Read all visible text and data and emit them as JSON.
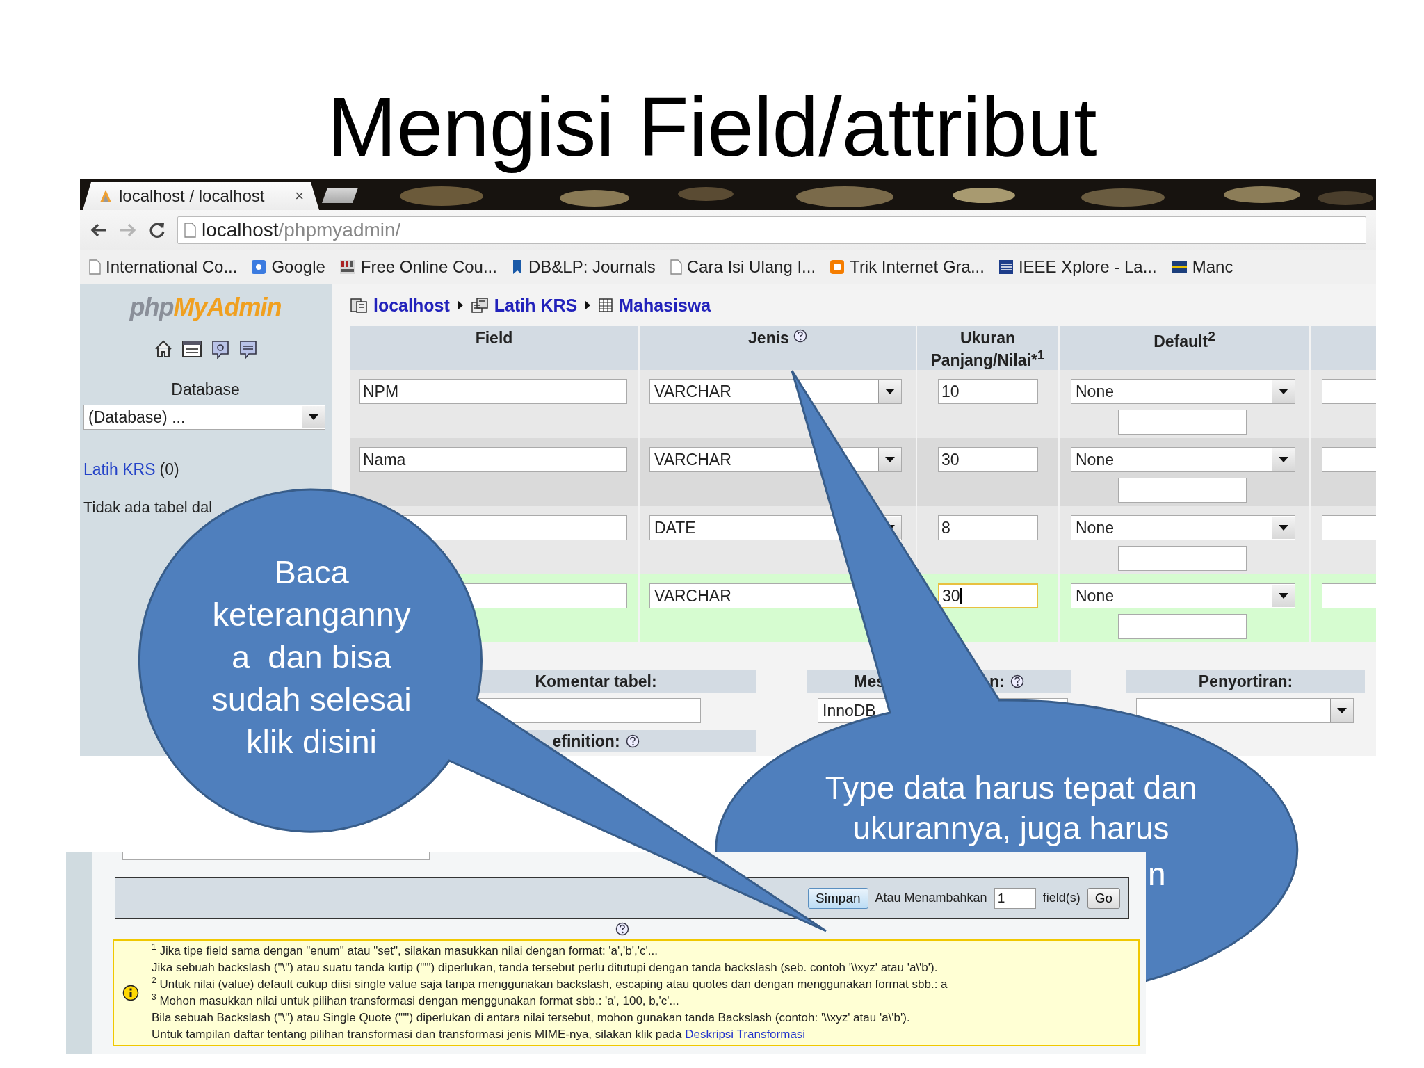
{
  "slide_title": "Mengisi Field/attribut",
  "browser": {
    "tab": {
      "title": "localhost / localhost",
      "close": "×"
    },
    "address": {
      "host": "localhost",
      "path": "/phpmyadmin/"
    },
    "bookmarks": [
      {
        "label": "International Co..."
      },
      {
        "label": "Google"
      },
      {
        "label": "Free Online Cou..."
      },
      {
        "label": "DB&LP: Journals"
      },
      {
        "label": "Cara Isi Ulang I..."
      },
      {
        "label": "Trik Internet Gra..."
      },
      {
        "label": "IEEE Xplore - La..."
      },
      {
        "label": "Manc"
      }
    ]
  },
  "sidebar": {
    "logo": {
      "part1": "php",
      "part2": "MyAdmin"
    },
    "database_label": "Database",
    "database_select": "(Database) ...",
    "db_link": "Latih KRS",
    "db_count": "(0)",
    "note": "Tidak ada tabel dal"
  },
  "breadcrumb": [
    {
      "label": "localhost"
    },
    {
      "label": "Latih KRS"
    },
    {
      "label": "Mahasiswa"
    }
  ],
  "columns": [
    {
      "label": "Field",
      "help": false
    },
    {
      "label": "Jenis",
      "help": true
    },
    {
      "label": "Ukuran Panjang/Nilai*",
      "note": "1",
      "help": false
    },
    {
      "label": "Default",
      "note": "2",
      "help": false
    }
  ],
  "rows": [
    {
      "field": "NPM",
      "type": "VARCHAR",
      "type_arrow_visible": true,
      "size": "10",
      "size_focused": false,
      "default": "None",
      "marked": false
    },
    {
      "field": "Nama",
      "type": "VARCHAR",
      "type_arrow_visible": true,
      "size": "30",
      "size_focused": false,
      "default": "None",
      "marked": false
    },
    {
      "type": "DATE",
      "type_arrow_visible": true,
      "size": "8",
      "size_focused": false,
      "default": "None",
      "marked": false
    },
    {
      "type": "VARCHAR",
      "type_arrow_visible": false,
      "size": "30",
      "size_focused": true,
      "default": "None",
      "marked": true
    }
  ],
  "table_options": {
    "comment_label": "Komentar tabel:",
    "definition_label": "efinition:",
    "engine_label_parts": [
      "Mes",
      "n:"
    ],
    "engine_value": "InnoDB",
    "sort_label": "Penyortiran:"
  },
  "save_bar": {
    "save_button": "Simpan",
    "add_label": "Atau Menambahkan",
    "add_count": "1",
    "add_unit": "field(s)",
    "go_button": "Go"
  },
  "notes": [
    {
      "text": "$^{1}$ Jika tipe field sama dengan \"enum\" atau \"set\", silakan masukkan nilai dengan format: 'a','b','c'..."
    },
    {
      "text": "Jika sebuah backslash (\"\\\") atau suatu tanda kutip (\"'\") diperlukan, tanda tersebut perlu ditutupi dengan tanda backslash (seb. contoh '\\\\xyz' atau 'a\\'b')."
    },
    {
      "text": "$^{2}$ Untuk nilai (value) default cukup diisi single value saja tanpa menggunakan backslash, escaping atau quotes dan dengan menggunakan format sbb.: a"
    },
    {
      "text": "$^{3}$ Mohon masukkan nilai untuk pilihan transformasi dengan menggunakan format sbb.: 'a', 100, b,'c'..."
    },
    {
      "text": "Bila sebuah Backslash (\"\\\") atau Single Quote (\"'\") diperlukan di antara nilai tersebut, mohon gunakan tanda Backslash (contoh: '\\\\xyz' atau 'a\\'b')."
    },
    {
      "text": "Untuk tampilan daftar tentang pilihan transformasi dan transformasi jenis MIME-nya, silakan klik pada ",
      "link": "Deskripsi Transformasi"
    }
  ],
  "callouts": [
    {
      "lines": [
        "Baca",
        "keteranganny",
        "a  dan bisa",
        "sudah selesai",
        "klik disini"
      ]
    },
    {
      "lines": [
        "Type data harus tepat dan",
        "ukurannya, juga harus"
      ],
      "tail_text": "n"
    }
  ]
}
